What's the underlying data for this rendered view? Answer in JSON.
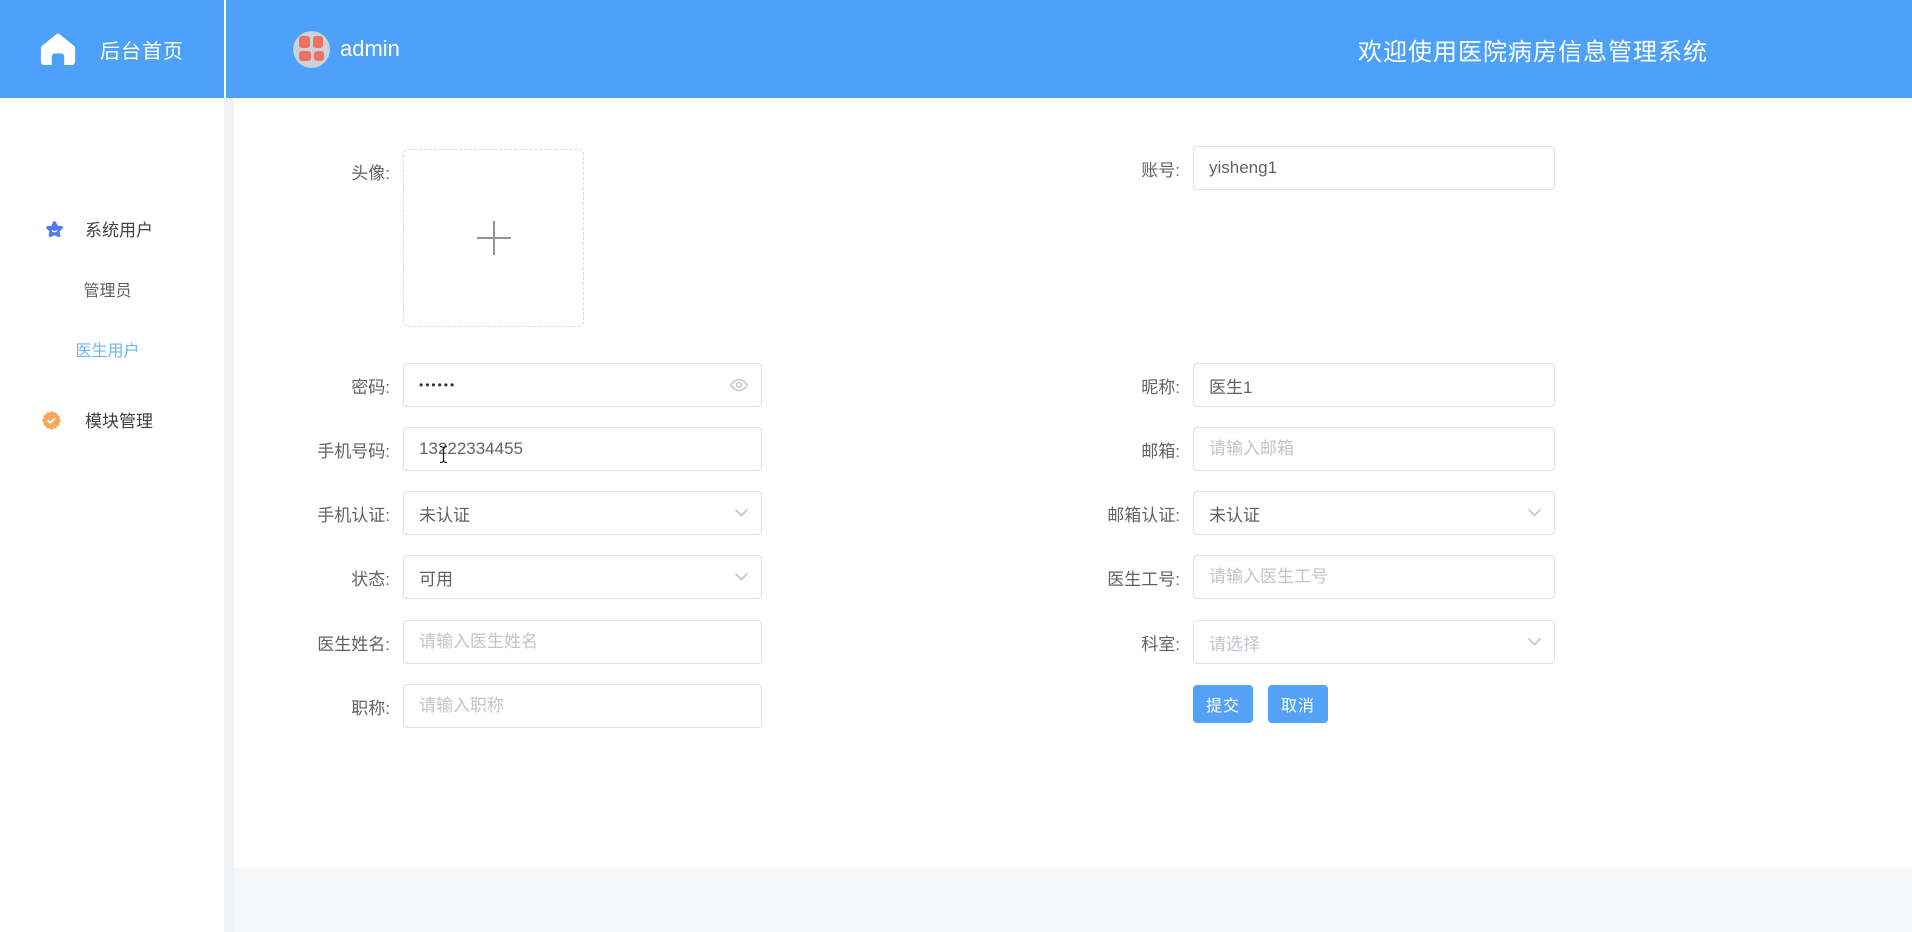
{
  "header": {
    "home_label": "后台首页",
    "username": "admin",
    "welcome_title": "欢迎使用医院病房信息管理系统"
  },
  "sidebar": {
    "items": [
      {
        "label": "系统用户",
        "icon": "star-icon"
      },
      {
        "label": "管理员"
      },
      {
        "label": "医生用户",
        "active": true
      },
      {
        "label": "模块管理",
        "icon": "badge-check-icon"
      }
    ]
  },
  "form": {
    "left": [
      {
        "label": "头像:",
        "type": "avatar-upload",
        "icon": "plus-icon"
      },
      {
        "label": "密码:",
        "type": "password",
        "value": "••••••",
        "icon": "eye-icon"
      },
      {
        "label": "手机号码:",
        "type": "text",
        "value": "13222334455"
      },
      {
        "label": "手机认证:",
        "type": "select",
        "value": "未认证"
      },
      {
        "label": "状态:",
        "type": "select",
        "value": "可用"
      },
      {
        "label": "医生姓名:",
        "type": "text",
        "placeholder": "请输入医生姓名"
      },
      {
        "label": "职称:",
        "type": "text",
        "placeholder": "请输入职称"
      }
    ],
    "right": [
      {
        "label": "账号:",
        "type": "text",
        "value": "yisheng1"
      },
      {
        "label": "昵称:",
        "type": "text",
        "value": "医生1"
      },
      {
        "label": "邮箱:",
        "type": "text",
        "placeholder": "请输入邮箱"
      },
      {
        "label": "邮箱认证:",
        "type": "select",
        "value": "未认证"
      },
      {
        "label": "医生工号:",
        "type": "text",
        "placeholder": "请输入医生工号"
      },
      {
        "label": "科室:",
        "type": "select",
        "placeholder": "请选择"
      }
    ],
    "buttons": {
      "submit": "提交",
      "cancel": "取消"
    }
  },
  "colors": {
    "primary_blue": "#4da1f8",
    "button_blue": "#54a2f8",
    "active_link": "#6fb3fa",
    "star_icon": "#4e7cf2",
    "badge_icon": "#f2a95f",
    "avatar_petal": "#ec7162",
    "border": "#dcdfe6",
    "placeholder": "#c0c4cc",
    "footer_bg": "#f5f6f8"
  }
}
